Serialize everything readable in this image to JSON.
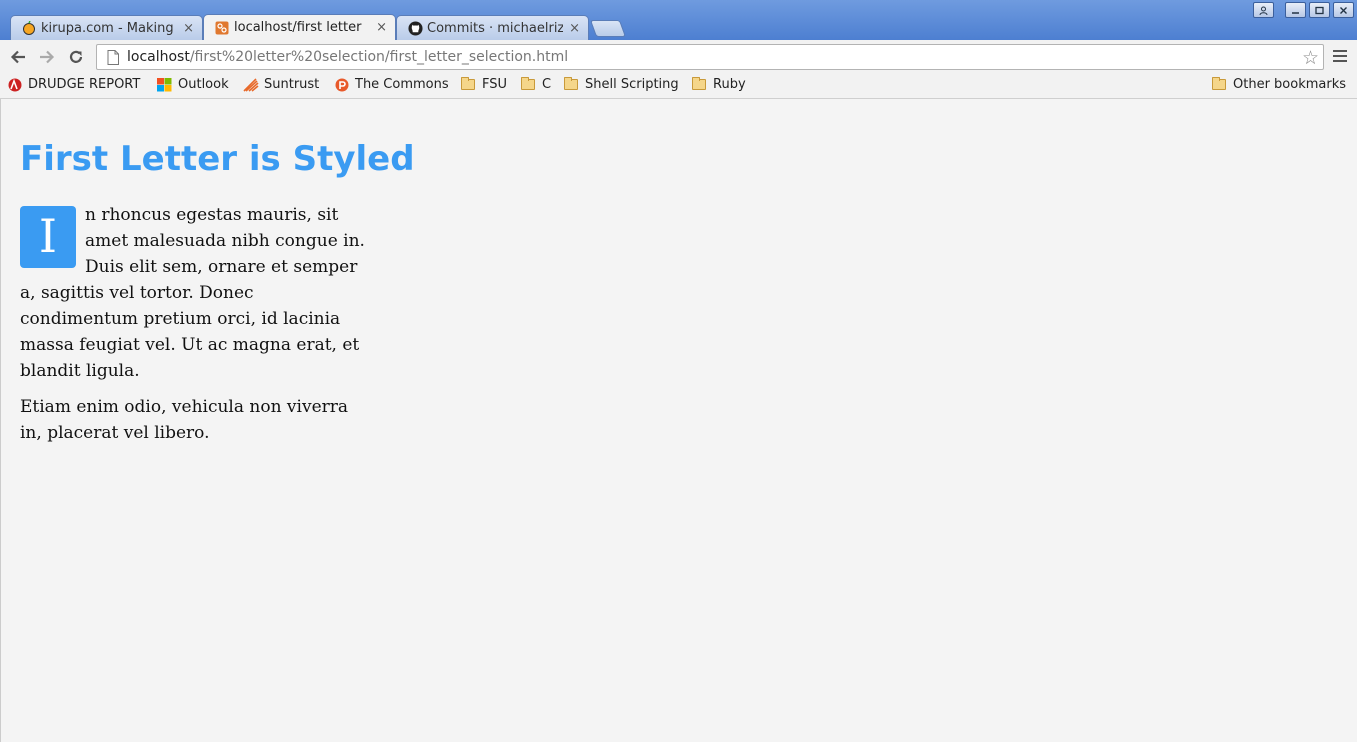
{
  "browser": {
    "tabs": [
      {
        "title": "kirupa.com - Making",
        "close": "×",
        "icon": "kirupa-favicon"
      },
      {
        "title": "localhost/first letter",
        "close": "×",
        "icon": "html5-favicon",
        "active": true
      },
      {
        "title": "Commits · michaelriz",
        "close": "×",
        "icon": "github-favicon"
      }
    ],
    "url": {
      "host": "localhost",
      "path": "/first%20letter%20selection/first_letter_selection.html"
    },
    "bookmarks": [
      {
        "label": "DRUDGE REPORT",
        "icon": "drudge-icon"
      },
      {
        "label": "Outlook",
        "icon": "outlook-icon"
      },
      {
        "label": "Suntrust",
        "icon": "suntrust-icon"
      },
      {
        "label": "The Commons",
        "icon": "commons-icon"
      },
      {
        "label": "FSU",
        "icon": "folder-icon"
      },
      {
        "label": "C",
        "icon": "folder-icon"
      },
      {
        "label": "Shell Scripting",
        "icon": "folder-icon"
      },
      {
        "label": "Ruby",
        "icon": "folder-icon"
      }
    ],
    "other_bookmarks": "Other bookmarks",
    "accent_color": "#3a9bf2"
  },
  "page": {
    "heading": "First Letter is Styled",
    "drop_cap": "I",
    "paragraph1_rest": "n rhoncus egestas mauris, sit amet malesuada nibh congue in. Duis elit sem, ornare et semper a, sagittis vel tortor. Donec condimentum pretium orci, id lacinia massa feugiat vel. Ut ac magna erat, et blandit ligula.",
    "paragraph2": "Etiam enim odio, vehicula non viverra in, placerat vel libero."
  }
}
